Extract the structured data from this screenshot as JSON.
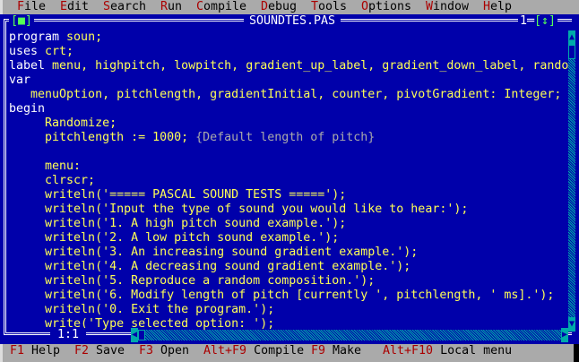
{
  "menu": [
    {
      "hot": "F",
      "rest": "ile"
    },
    {
      "hot": "E",
      "rest": "dit"
    },
    {
      "hot": "S",
      "rest": "earch"
    },
    {
      "hot": "R",
      "rest": "un"
    },
    {
      "hot": "C",
      "rest": "ompile"
    },
    {
      "hot": "D",
      "rest": "ebug"
    },
    {
      "hot": "T",
      "rest": "ools"
    },
    {
      "hot": "O",
      "rest": "ptions"
    },
    {
      "hot": "W",
      "rest": "indow"
    },
    {
      "hot": "H",
      "rest": "elp"
    }
  ],
  "window": {
    "title": "SOUNDTES.PAS",
    "close": "[■]",
    "number": "1",
    "zoom": "[↕]",
    "cursor_pos": "1:1"
  },
  "code": [
    [
      {
        "t": "program ",
        "c": "kw"
      },
      {
        "t": "soun;",
        "c": "id"
      }
    ],
    [
      {
        "t": "uses ",
        "c": "kw"
      },
      {
        "t": "crt;",
        "c": "id"
      }
    ],
    [
      {
        "t": "label ",
        "c": "kw"
      },
      {
        "t": "menu, highpitch, lowpitch, gradient_up_label, gradient_down_label, rando",
        "c": "id"
      }
    ],
    [
      {
        "t": "var",
        "c": "kw"
      }
    ],
    [
      {
        "t": "   menuOption, pitchlength, gradientInitial, counter, pivotGradient: Integer;",
        "c": "id"
      }
    ],
    [
      {
        "t": "begin",
        "c": "kw"
      }
    ],
    [
      {
        "t": "     Randomize;",
        "c": "id"
      }
    ],
    [
      {
        "t": "     pitchlength := 1000; ",
        "c": "id"
      },
      {
        "t": "{Default length of pitch}",
        "c": "cm"
      }
    ],
    [
      {
        "t": "",
        "c": "id"
      }
    ],
    [
      {
        "t": "     menu:",
        "c": "id"
      }
    ],
    [
      {
        "t": "     clrscr;",
        "c": "id"
      }
    ],
    [
      {
        "t": "     writeln('===== PASCAL SOUND TESTS =====');",
        "c": "id"
      }
    ],
    [
      {
        "t": "     writeln('Input the type of sound you would like to hear:');",
        "c": "id"
      }
    ],
    [
      {
        "t": "     writeln('1. A high pitch sound example.');",
        "c": "id"
      }
    ],
    [
      {
        "t": "     writeln('2. A low pitch sound example.');",
        "c": "id"
      }
    ],
    [
      {
        "t": "     writeln('3. An increasing sound gradient example.');",
        "c": "id"
      }
    ],
    [
      {
        "t": "     writeln('4. A decreasing sound gradient example.');",
        "c": "id"
      }
    ],
    [
      {
        "t": "     writeln('5. Reproduce a random composition.');",
        "c": "id"
      }
    ],
    [
      {
        "t": "     writeln('6. Modify length of pitch [currently ', pitchlength, ' ms].');",
        "c": "id"
      }
    ],
    [
      {
        "t": "     writeln('0. Exit the program.');",
        "c": "id"
      }
    ],
    [
      {
        "t": "     write('Type selected option: ');",
        "c": "id"
      }
    ]
  ],
  "status": [
    {
      "key": "F1",
      "label": "Help"
    },
    {
      "key": "F2",
      "label": "Save"
    },
    {
      "key": "F3",
      "label": "Open"
    },
    {
      "key": "Alt+F9",
      "label": "Compile"
    },
    {
      "key": "F9",
      "label": "Make"
    },
    {
      "key": "Alt+F10",
      "label": "Local menu"
    }
  ],
  "colors": {
    "background": "#0000AA",
    "keyword": "#FFFFFF",
    "identifier": "#FFFF55",
    "comment": "#AAAAAA",
    "menu_bg": "#AAAAAA",
    "hotkey": "#AA0000",
    "scrollbar": "#00AAAA"
  }
}
